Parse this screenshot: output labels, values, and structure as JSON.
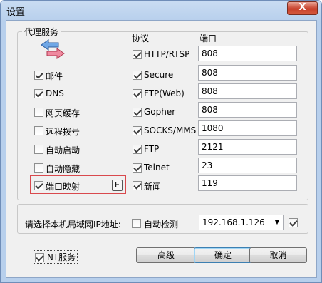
{
  "dialog": {
    "title": "设置",
    "close_symbol": "X"
  },
  "proxy_group": {
    "title": "代理服务",
    "icon": "transfer-arrows-icon",
    "col_protocol": "协议",
    "col_port": "端口",
    "left_options": [
      {
        "label": "邮件",
        "checked": true
      },
      {
        "label": "DNS",
        "checked": true
      },
      {
        "label": "网页缓存",
        "checked": false
      },
      {
        "label": "远程拨号",
        "checked": false
      },
      {
        "label": "自动启动",
        "checked": false
      },
      {
        "label": "自动隐藏",
        "checked": false
      },
      {
        "label": "端口映射",
        "checked": true
      }
    ],
    "port_map_key": "E",
    "protocols": [
      {
        "label": "HTTP/RTSP",
        "checked": true,
        "port": "808"
      },
      {
        "label": "Secure",
        "checked": true,
        "port": "808"
      },
      {
        "label": "FTP(Web)",
        "checked": true,
        "port": "808"
      },
      {
        "label": "Gopher",
        "checked": true,
        "port": "808"
      },
      {
        "label": "SOCKS/MMS",
        "checked": true,
        "port": "1080"
      },
      {
        "label": "FTP",
        "checked": true,
        "port": "2121"
      },
      {
        "label": "Telnet",
        "checked": true,
        "port": "23"
      },
      {
        "label": "新闻",
        "checked": true,
        "port": "119"
      }
    ]
  },
  "lan_group": {
    "label": "请选择本机局域网IP地址:",
    "auto_detect_label": "自动检测",
    "auto_detect_checked": false,
    "ip_value": "192.168.1.126",
    "extra_checked": true
  },
  "footer": {
    "nt_service_label": "NT服务",
    "nt_service_checked": true,
    "advanced": "高级",
    "ok": "确定",
    "cancel": "取消"
  }
}
